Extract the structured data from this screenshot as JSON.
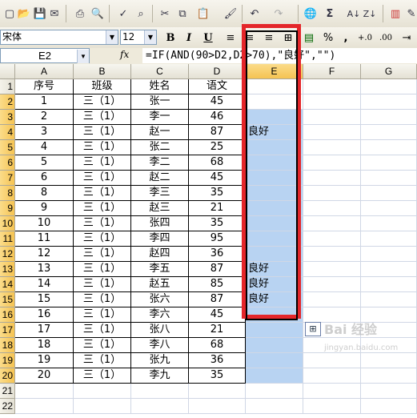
{
  "toolbar": {
    "font_name": "宋体",
    "font_size": "12",
    "bold": "B",
    "italic": "I",
    "underline": "U",
    "percent": "%",
    "comma": ",",
    "sigma": "Σ"
  },
  "formula_bar": {
    "name_box": "E2",
    "fx": "fx",
    "formula": "=IF(AND(90>D2,D2>70),\"良好\",\"\")"
  },
  "columns": [
    "A",
    "B",
    "C",
    "D",
    "E",
    "F",
    "G"
  ],
  "selected_column": "E",
  "headers": [
    "序号",
    "班级",
    "姓名",
    "语文"
  ],
  "rows": [
    {
      "num": "1",
      "cls": "三（1）",
      "name": "张一",
      "score": "45",
      "result": ""
    },
    {
      "num": "2",
      "cls": "三（1）",
      "name": "李一",
      "score": "46",
      "result": ""
    },
    {
      "num": "3",
      "cls": "三（1）",
      "name": "赵一",
      "score": "87",
      "result": "良好"
    },
    {
      "num": "4",
      "cls": "三（1）",
      "name": "张二",
      "score": "25",
      "result": ""
    },
    {
      "num": "5",
      "cls": "三（1）",
      "name": "李二",
      "score": "68",
      "result": ""
    },
    {
      "num": "6",
      "cls": "三（1）",
      "name": "赵二",
      "score": "45",
      "result": ""
    },
    {
      "num": "8",
      "cls": "三（1）",
      "name": "李三",
      "score": "35",
      "result": ""
    },
    {
      "num": "9",
      "cls": "三（1）",
      "name": "赵三",
      "score": "21",
      "result": ""
    },
    {
      "num": "10",
      "cls": "三（1）",
      "name": "张四",
      "score": "35",
      "result": ""
    },
    {
      "num": "11",
      "cls": "三（1）",
      "name": "李四",
      "score": "95",
      "result": ""
    },
    {
      "num": "12",
      "cls": "三（1）",
      "name": "赵四",
      "score": "36",
      "result": ""
    },
    {
      "num": "13",
      "cls": "三（1）",
      "name": "李五",
      "score": "87",
      "result": "良好"
    },
    {
      "num": "14",
      "cls": "三（1）",
      "name": "赵五",
      "score": "85",
      "result": "良好"
    },
    {
      "num": "15",
      "cls": "三（1）",
      "name": "张六",
      "score": "87",
      "result": "良好"
    },
    {
      "num": "16",
      "cls": "三（1）",
      "name": "李六",
      "score": "45",
      "result": ""
    },
    {
      "num": "17",
      "cls": "三（1）",
      "name": "张八",
      "score": "21",
      "result": ""
    },
    {
      "num": "18",
      "cls": "三（1）",
      "name": "李八",
      "score": "68",
      "result": ""
    },
    {
      "num": "19",
      "cls": "三（1）",
      "name": "张九",
      "score": "36",
      "result": ""
    },
    {
      "num": "20",
      "cls": "三（1）",
      "name": "李九",
      "score": "35",
      "result": ""
    }
  ],
  "row_numbers": [
    "1",
    "2",
    "3",
    "4",
    "5",
    "6",
    "7",
    "8",
    "9",
    "10",
    "11",
    "12",
    "13",
    "14",
    "15",
    "16",
    "17",
    "18",
    "19",
    "20",
    "21",
    "22"
  ],
  "watermark": "Bai 经验",
  "watermark_sub": "jingyan.baidu.com",
  "colors": {
    "selection_fill": "#b8d3f2",
    "highlight_border": "#e4262a",
    "header_selected": "#f5c352"
  }
}
